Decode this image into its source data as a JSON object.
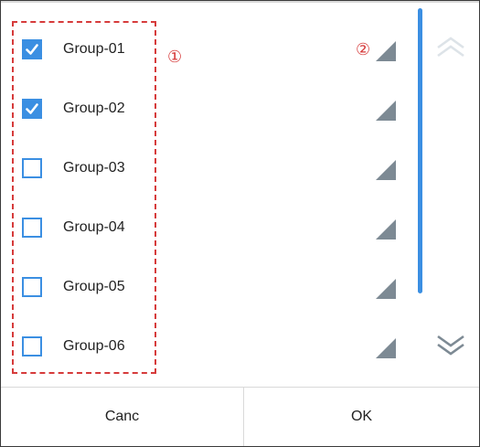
{
  "groups": [
    {
      "label": "Group-01",
      "checked": true
    },
    {
      "label": "Group-02",
      "checked": true
    },
    {
      "label": "Group-03",
      "checked": false
    },
    {
      "label": "Group-04",
      "checked": false
    },
    {
      "label": "Group-05",
      "checked": false
    },
    {
      "label": "Group-06",
      "checked": false
    }
  ],
  "annotations": {
    "one": "①",
    "two": "②"
  },
  "footer": {
    "cancel_label": "Canc",
    "ok_label": "OK"
  },
  "colors": {
    "accent": "#3b8fe2",
    "annotation": "#d63b3b",
    "triangle": "#7d8a94"
  },
  "icons": {
    "checkbox_checked": "checkmark-icon",
    "row_indicator": "corner-triangle-icon",
    "scroll_up": "double-chevron-up-icon",
    "scroll_down": "double-chevron-down-icon"
  }
}
